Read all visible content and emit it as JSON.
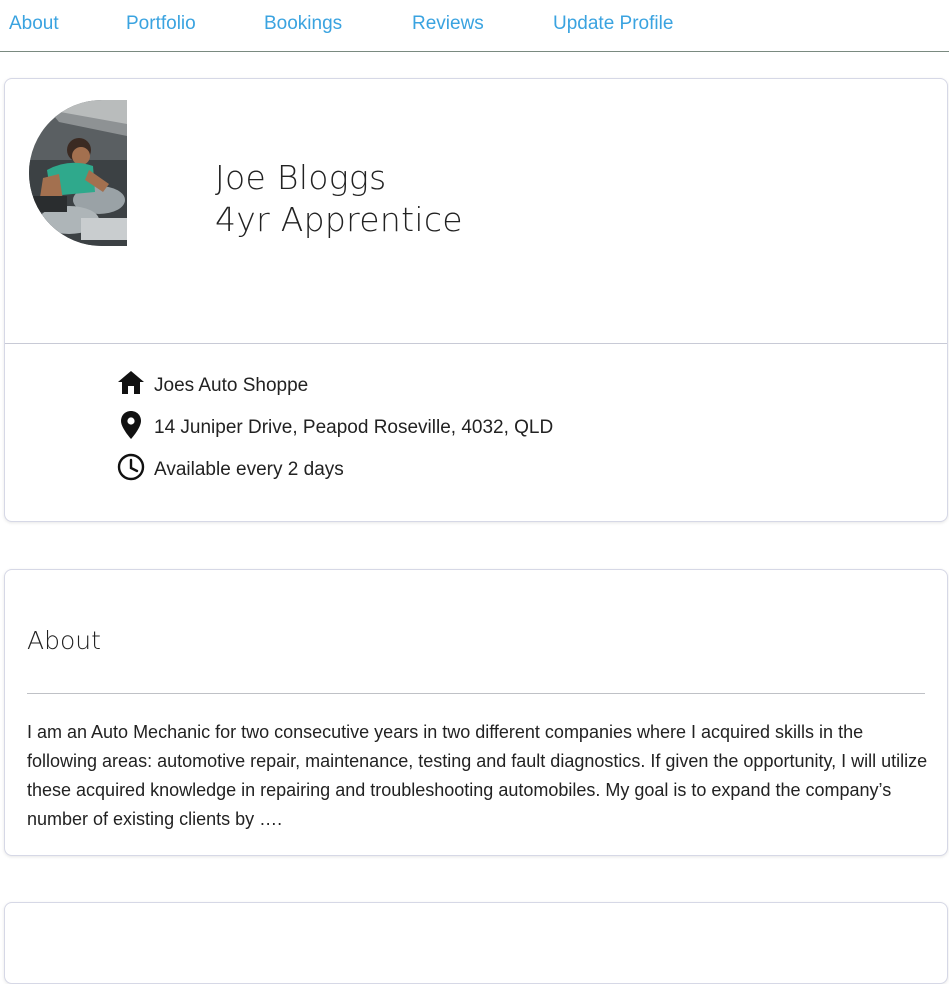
{
  "nav": {
    "items": [
      "About",
      "Portfolio",
      "Bookings",
      "Reviews",
      "Update Profile"
    ]
  },
  "profile": {
    "name": "Joe Bloggs",
    "role": "4yr Apprentice",
    "avatar_icon": "mechanic-photo",
    "details": [
      {
        "icon": "home-icon",
        "text": "Joes Auto Shoppe"
      },
      {
        "icon": "location-pin-icon",
        "text": "14 Juniper Drive, Peapod Roseville, 4032, QLD"
      },
      {
        "icon": "clock-icon",
        "text": "Available every 2 days"
      }
    ]
  },
  "about": {
    "title": "About",
    "body": "I am an Auto Mechanic for two consecutive years in two different companies where I acquired skills in the following areas: automotive repair, maintenance, testing and fault diagnostics. If given the opportunity, I will utilize these acquired knowledge in repairing and troubleshooting automobiles. My goal is to expand the company’s number of existing clients by …."
  },
  "colors": {
    "link": "#3aa3e0",
    "text": "#222222",
    "card_border": "#d6d8e6"
  }
}
